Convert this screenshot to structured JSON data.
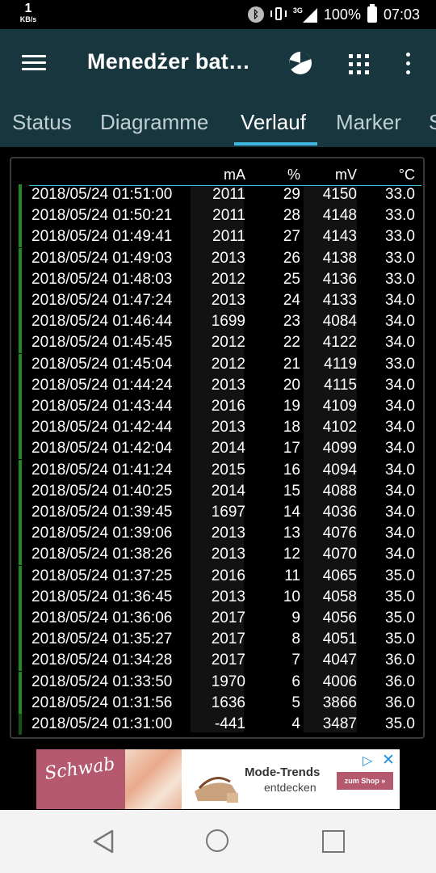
{
  "status_bar": {
    "speed_value": "1",
    "speed_unit": "KB/s",
    "network_type": "3G",
    "battery_percent": "100%",
    "time": "07:03",
    "icons": [
      "bluetooth-icon",
      "vibrate-icon",
      "signal-icon",
      "battery-icon"
    ]
  },
  "toolbar": {
    "title": "Menedżer bat…",
    "icons": [
      "menu-icon",
      "pie-chart-icon",
      "grid-icon",
      "more-vert-icon"
    ]
  },
  "tabs": [
    {
      "label": "Status",
      "active": false
    },
    {
      "label": "Diagramme",
      "active": false
    },
    {
      "label": "Verlauf",
      "active": true
    },
    {
      "label": "Marker",
      "active": false
    },
    {
      "label": "S",
      "active": false
    }
  ],
  "table": {
    "headers": {
      "ma": "mA",
      "pct": "%",
      "mv": "mV",
      "temp": "°C"
    },
    "rows": [
      {
        "date": "2018/05/24 01:51:00",
        "ma": "2011",
        "pct": "29",
        "mv": "4150",
        "temp": "33.0"
      },
      {
        "date": "2018/05/24 01:50:21",
        "ma": "2011",
        "pct": "28",
        "mv": "4148",
        "temp": "33.0"
      },
      {
        "date": "2018/05/24 01:49:41",
        "ma": "2011",
        "pct": "27",
        "mv": "4143",
        "temp": "33.0"
      },
      {
        "date": "2018/05/24 01:49:03",
        "ma": "2013",
        "pct": "26",
        "mv": "4138",
        "temp": "33.0"
      },
      {
        "date": "2018/05/24 01:48:03",
        "ma": "2012",
        "pct": "25",
        "mv": "4136",
        "temp": "33.0"
      },
      {
        "date": "2018/05/24 01:47:24",
        "ma": "2013",
        "pct": "24",
        "mv": "4133",
        "temp": "34.0"
      },
      {
        "date": "2018/05/24 01:46:44",
        "ma": "1699",
        "pct": "23",
        "mv": "4084",
        "temp": "34.0"
      },
      {
        "date": "2018/05/24 01:45:45",
        "ma": "2012",
        "pct": "22",
        "mv": "4122",
        "temp": "34.0"
      },
      {
        "date": "2018/05/24 01:45:04",
        "ma": "2012",
        "pct": "21",
        "mv": "4119",
        "temp": "33.0"
      },
      {
        "date": "2018/05/24 01:44:24",
        "ma": "2013",
        "pct": "20",
        "mv": "4115",
        "temp": "34.0"
      },
      {
        "date": "2018/05/24 01:43:44",
        "ma": "2016",
        "pct": "19",
        "mv": "4109",
        "temp": "34.0"
      },
      {
        "date": "2018/05/24 01:42:44",
        "ma": "2013",
        "pct": "18",
        "mv": "4102",
        "temp": "34.0"
      },
      {
        "date": "2018/05/24 01:42:04",
        "ma": "2014",
        "pct": "17",
        "mv": "4099",
        "temp": "34.0"
      },
      {
        "date": "2018/05/24 01:41:24",
        "ma": "2015",
        "pct": "16",
        "mv": "4094",
        "temp": "34.0"
      },
      {
        "date": "2018/05/24 01:40:25",
        "ma": "2014",
        "pct": "15",
        "mv": "4088",
        "temp": "34.0"
      },
      {
        "date": "2018/05/24 01:39:45",
        "ma": "1697",
        "pct": "14",
        "mv": "4036",
        "temp": "34.0"
      },
      {
        "date": "2018/05/24 01:39:06",
        "ma": "2013",
        "pct": "13",
        "mv": "4076",
        "temp": "34.0"
      },
      {
        "date": "2018/05/24 01:38:26",
        "ma": "2013",
        "pct": "12",
        "mv": "4070",
        "temp": "34.0"
      },
      {
        "date": "2018/05/24 01:37:25",
        "ma": "2016",
        "pct": "11",
        "mv": "4065",
        "temp": "35.0"
      },
      {
        "date": "2018/05/24 01:36:45",
        "ma": "2013",
        "pct": "10",
        "mv": "4058",
        "temp": "35.0"
      },
      {
        "date": "2018/05/24 01:36:06",
        "ma": "2017",
        "pct": "9",
        "mv": "4056",
        "temp": "35.0"
      },
      {
        "date": "2018/05/24 01:35:27",
        "ma": "2017",
        "pct": "8",
        "mv": "4051",
        "temp": "35.0"
      },
      {
        "date": "2018/05/24 01:34:28",
        "ma": "2017",
        "pct": "7",
        "mv": "4047",
        "temp": "36.0"
      },
      {
        "date": "2018/05/24 01:33:50",
        "ma": "1970",
        "pct": "6",
        "mv": "4006",
        "temp": "36.0"
      },
      {
        "date": "2018/05/24 01:31:56",
        "ma": "1636",
        "pct": "5",
        "mv": "3866",
        "temp": "36.0"
      },
      {
        "date": "2018/05/24 01:31:00",
        "ma": "-441",
        "pct": "4",
        "mv": "3487",
        "temp": "35.0"
      }
    ],
    "charging_color": "#1f8a1f",
    "last_row_color": "#145214"
  },
  "ad": {
    "brand": "Schwab",
    "headline": "Mode-Trends",
    "subline": "entdecken",
    "button": "zum Shop »",
    "brand_color": "#b5596f"
  },
  "nav": {
    "icons": [
      "back-icon",
      "home-icon",
      "recent-apps-icon"
    ]
  },
  "colors": {
    "appbar": "#17363e",
    "accent": "#3fb7df"
  }
}
